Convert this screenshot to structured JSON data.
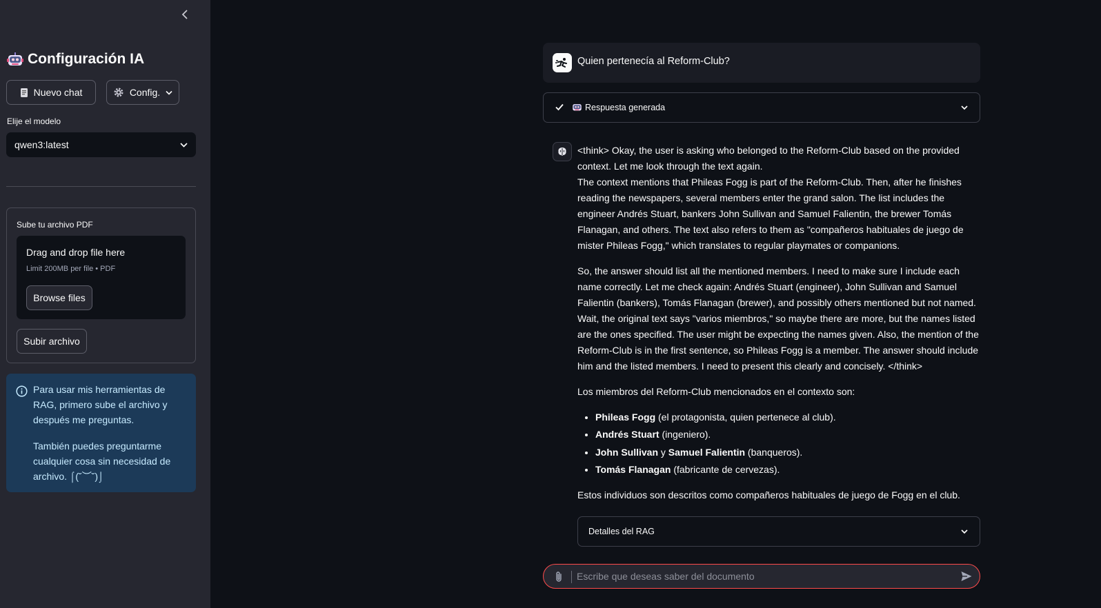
{
  "sidebar": {
    "title": "Configuración IA",
    "new_chat_label": "Nuevo chat",
    "config_label": "Config.",
    "model_label": "Elije el modelo",
    "model_value": "qwen3:latest",
    "upload_label": "Sube tu archivo PDF",
    "dropzone_title": "Drag and drop file here",
    "dropzone_limit": "Limit 200MB per file • PDF",
    "browse_label": "Browse files",
    "upload_button_label": "Subir archivo",
    "info_p1": "Para usar mis herramientas de RAG, primero sube el archivo y después me preguntas.",
    "info_p2": "También puedes preguntarme cualquier cosa sin necesidad de archivo. ⌠(˘︶˘)⌡"
  },
  "chat": {
    "user_message": "Quien pertenecía al Reform-Club?",
    "status_label": "Respuesta generada",
    "think_1": "<think> Okay, the user is asking who belonged to the Reform-Club based on the provided context. Let me look through the text again.",
    "think_2": "The context mentions that Phileas Fogg is part of the Reform-Club. Then, after he finishes reading the newspapers, several members enter the grand salon. The list includes the engineer Andrés Stuart, bankers John Sullivan and Samuel Falientin, the brewer Tomás Flanagan, and others. The text also refers to them as \"compañeros habituales de juego de mister Phileas Fogg,\" which translates to regular playmates or companions.",
    "think_3": "So, the answer should list all the mentioned members. I need to make sure I include each name correctly. Let me check again: Andrés Stuart (engineer), John Sullivan and Samuel Falientin (bankers), Tomás Flanagan (brewer), and possibly others mentioned but not named. Wait, the original text says \"varios miembros,\" so maybe there are more, but the names listed are the ones specified. The user might be expecting the names given. Also, the mention of the Reform-Club is in the first sentence, so Phileas Fogg is a member. The answer should include him and the listed members. I need to present this clearly and concisely. </think>",
    "intro": "Los miembros del Reform-Club mencionados en el contexto son:",
    "members": [
      {
        "name": "Phileas Fogg",
        "desc": " (el protagonista, quien pertenece al club)."
      },
      {
        "name": "Andrés Stuart",
        "desc": " (ingeniero)."
      },
      {
        "name": "John Sullivan",
        "join": " y ",
        "name2": "Samuel Falientin",
        "desc": " (banqueros)."
      },
      {
        "name": "Tomás Flanagan",
        "desc": " (fabricante de cervezas)."
      }
    ],
    "closing": "Estos individuos son descritos como compañeros habituales de juego de Fogg en el club.",
    "rag_details_label": "Detalles del RAG",
    "input_placeholder": "Escribe que deseas saber del documento"
  },
  "colors": {
    "sidebar_bg": "#262730",
    "main_bg": "#0e1117",
    "info_bg": "#1c3a58",
    "input_border": "#ff4b4b"
  }
}
